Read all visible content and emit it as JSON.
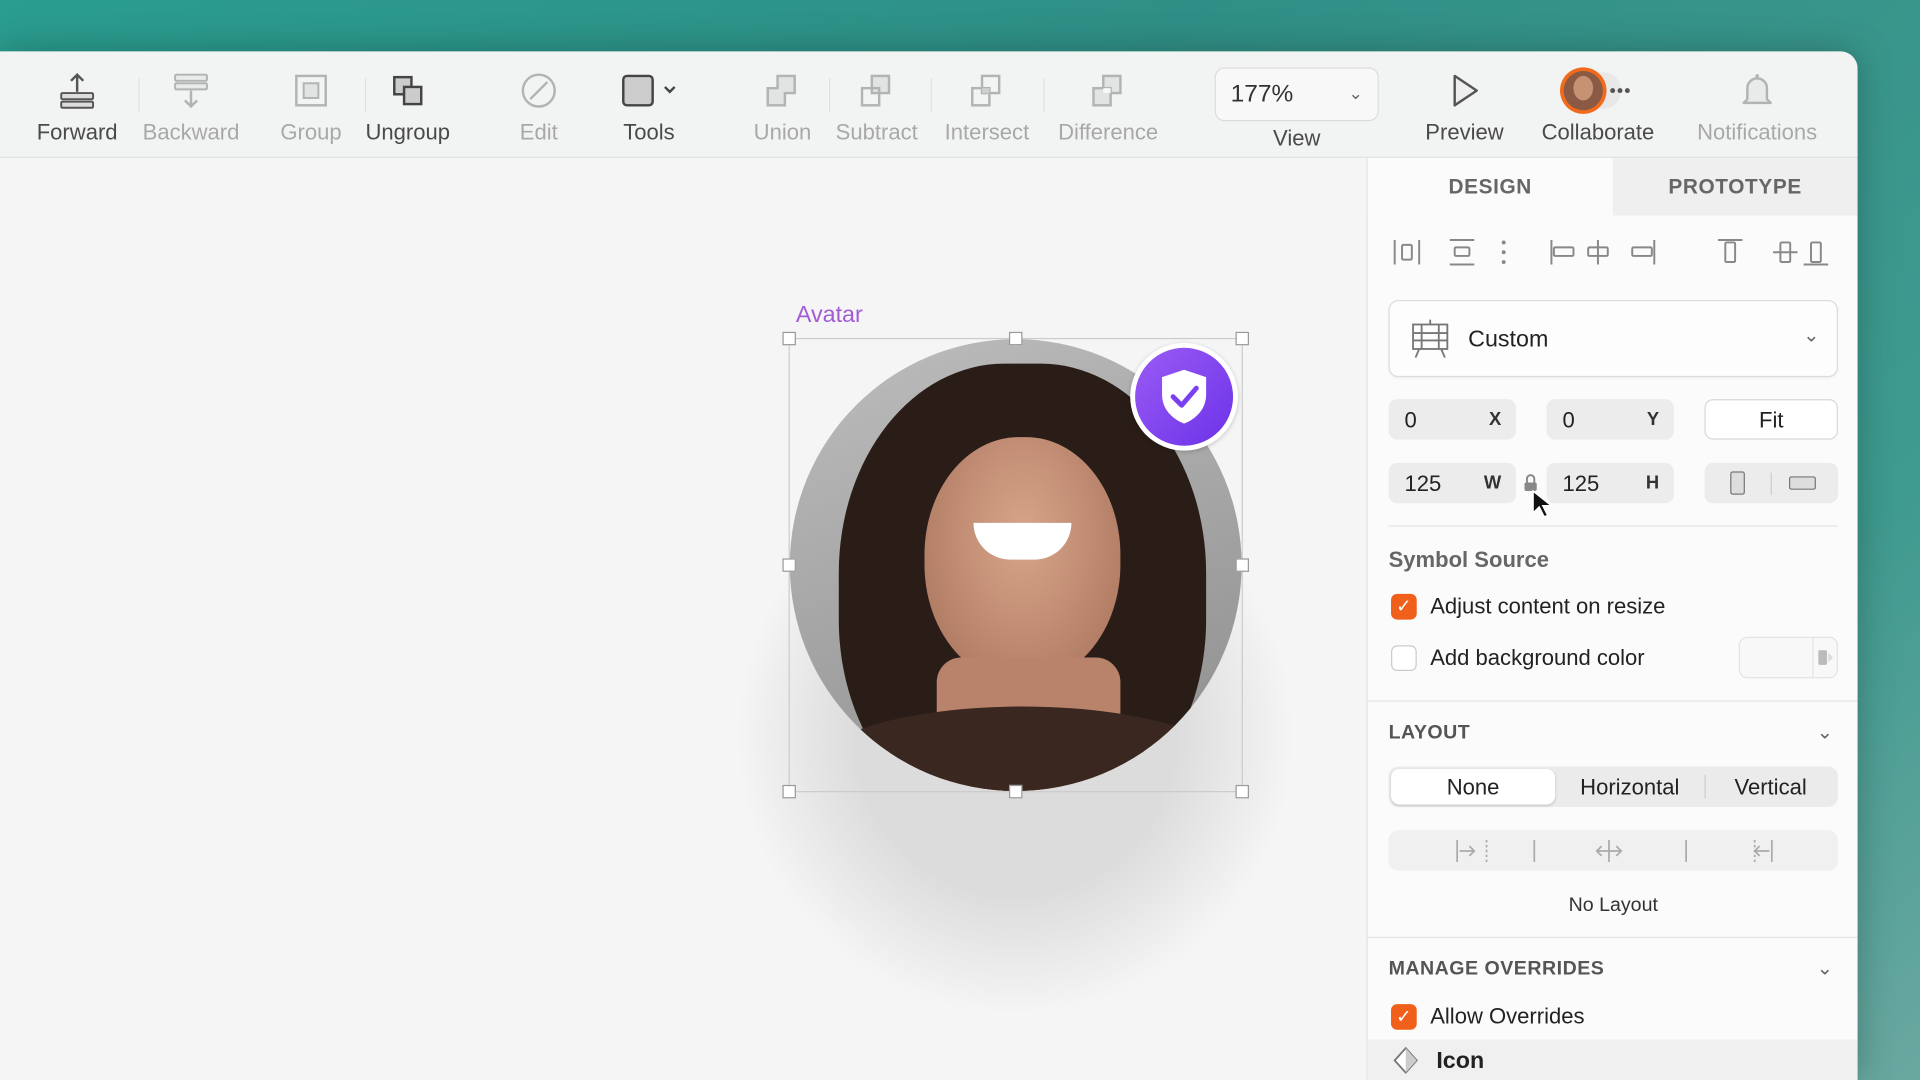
{
  "toolbar": {
    "forward": "Forward",
    "backward": "Backward",
    "group": "Group",
    "ungroup": "Ungroup",
    "edit": "Edit",
    "tools": "Tools",
    "union": "Union",
    "subtract": "Subtract",
    "intersect": "Intersect",
    "difference": "Difference",
    "zoom": "177%",
    "view": "View",
    "preview": "Preview",
    "collaborate": "Collaborate",
    "notifications": "Notifications"
  },
  "canvas": {
    "artboard_label": "Avatar",
    "accent": "#a25bd6",
    "badge_color": "#7b3ff2"
  },
  "panel": {
    "tabs": [
      "DESIGN",
      "PROTOTYPE"
    ],
    "preset": "Custom",
    "x": "0",
    "y": "0",
    "x_label": "X",
    "y_label": "Y",
    "fit": "Fit",
    "w": "125",
    "h": "125",
    "w_label": "W",
    "h_label": "H",
    "symbol_source": "Symbol Source",
    "adjust_content": "Adjust content on resize",
    "add_bg": "Add background color",
    "layout": "LAYOUT",
    "layout_options": [
      "None",
      "Horizontal",
      "Vertical"
    ],
    "no_layout": "No Layout",
    "manage_overrides": "MANAGE OVERRIDES",
    "allow_overrides": "Allow Overrides",
    "override_item": "Icon",
    "checkbox_color": "#f0601b"
  }
}
